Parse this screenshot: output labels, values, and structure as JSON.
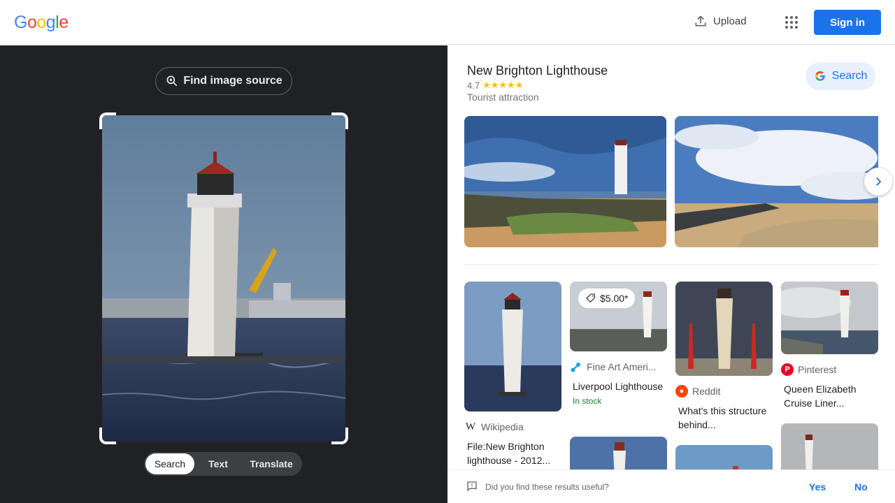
{
  "header": {
    "logo_letters": [
      {
        "char": "G",
        "color": "#4285f4"
      },
      {
        "char": "o",
        "color": "#ea4335"
      },
      {
        "char": "o",
        "color": "#fbbc05"
      },
      {
        "char": "g",
        "color": "#4285f4"
      },
      {
        "char": "l",
        "color": "#34a853"
      },
      {
        "char": "e",
        "color": "#ea4335"
      }
    ],
    "upload_label": "Upload",
    "upload_icon": "upload-icon",
    "apps_icon": "apps-grid-icon",
    "signin_label": "Sign in"
  },
  "left": {
    "find_source_label": "Find image source",
    "find_source_icon": "lens-search-icon",
    "modes": [
      {
        "label": "Search",
        "active": true
      },
      {
        "label": "Text",
        "active": false
      },
      {
        "label": "Translate",
        "active": false
      }
    ]
  },
  "knowledge_panel": {
    "title": "New Brighton Lighthouse",
    "rating": "4.7",
    "stars": "★★★★★",
    "type": "Tourist attraction",
    "search_label": "Search"
  },
  "results": [
    {
      "source": "Wikipedia",
      "title": "File:New Brighton lighthouse - 2012...",
      "icon": "wikipedia-icon"
    },
    {
      "source": "Fine Art Ameri...",
      "title": "Liverpool Lighthouse",
      "stock": "In stock",
      "price": "$5.00*",
      "icon": "fine-art-america-icon"
    },
    {
      "source": "Reddit",
      "title": "What's this structure behind...",
      "icon": "reddit-icon"
    },
    {
      "source": "Pinterest",
      "title": "Queen Elizabeth Cruise Liner...",
      "icon": "pinterest-icon"
    }
  ],
  "feedback": {
    "question": "Did you find these results useful?",
    "yes": "Yes",
    "no": "No"
  },
  "colors": {
    "accent": "#1a73e8",
    "dark_bg": "#202124",
    "stock_green": "#188038"
  }
}
